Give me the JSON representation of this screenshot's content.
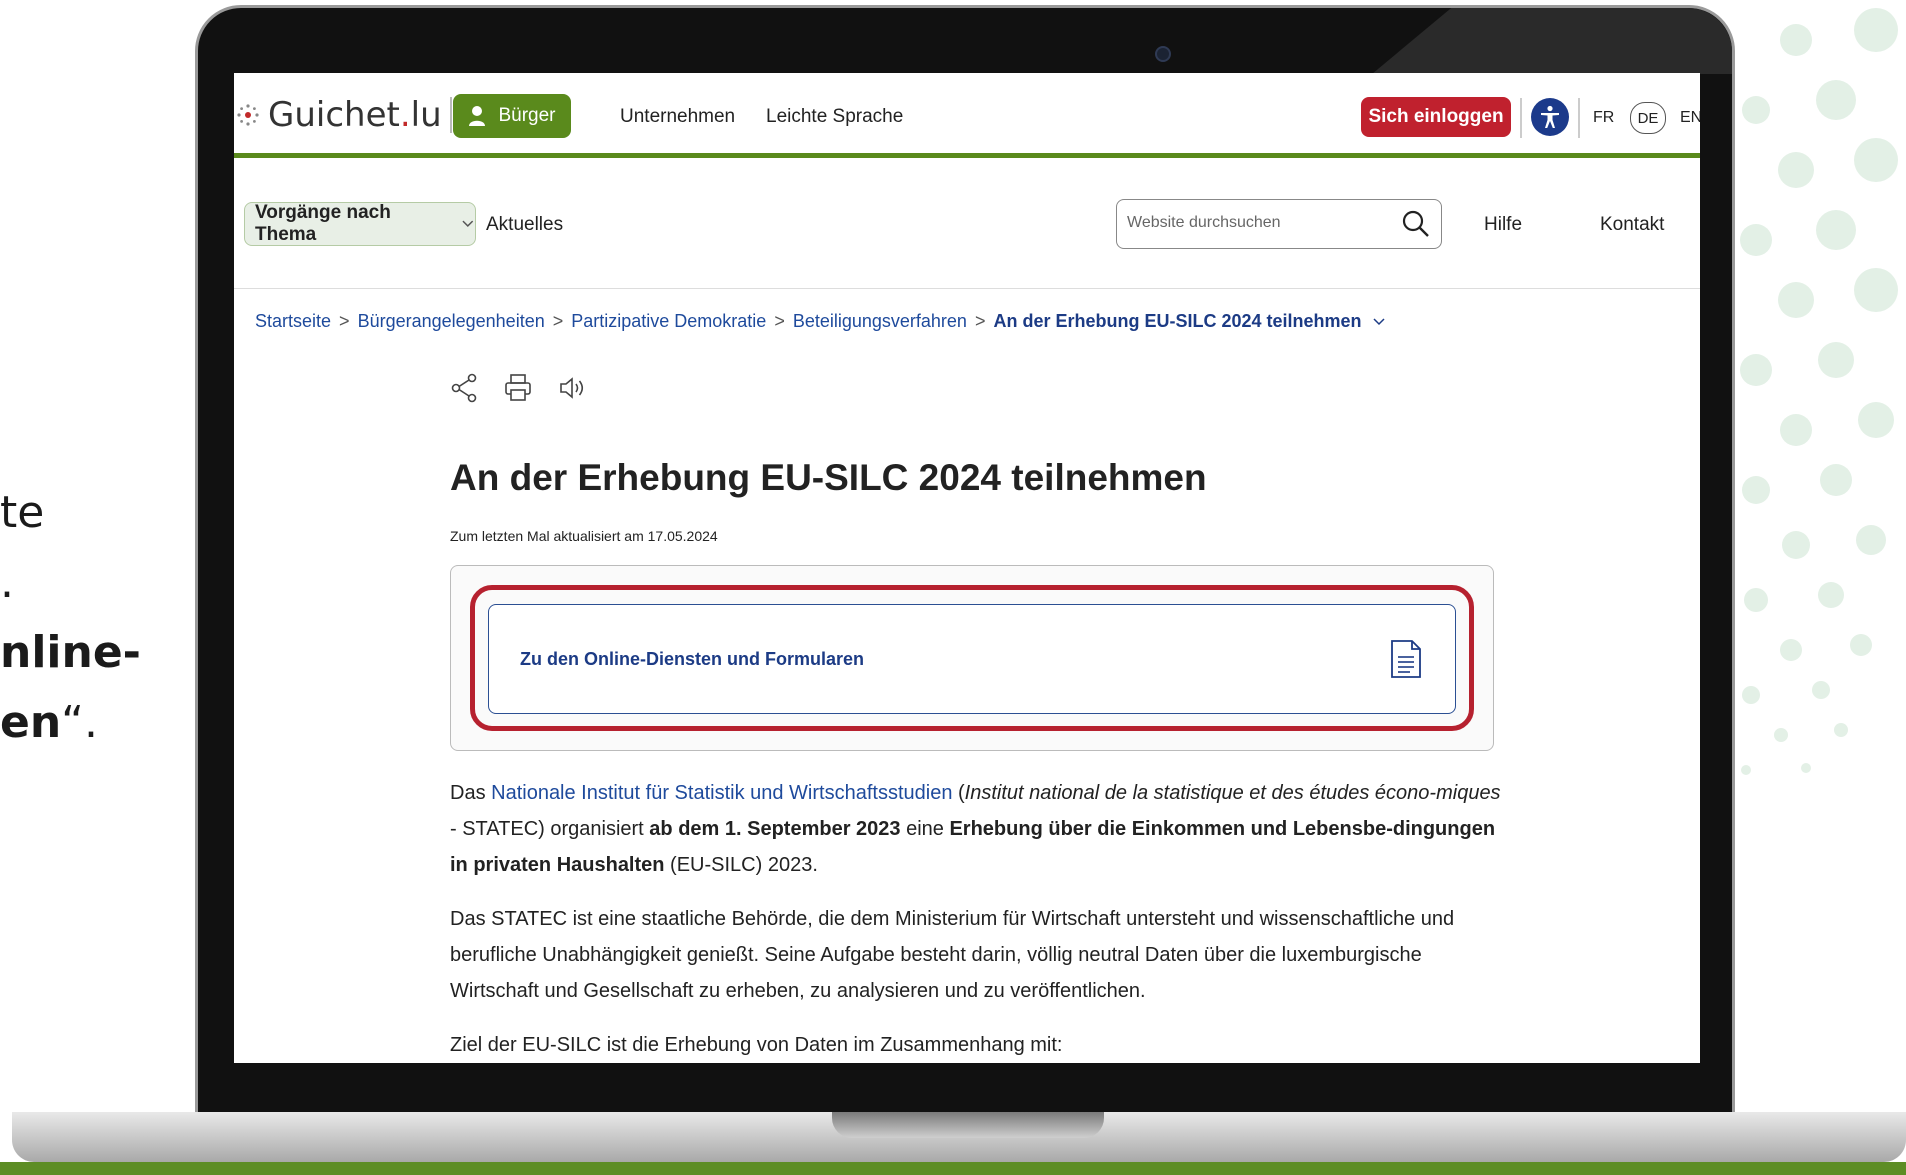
{
  "side_text": {
    "line1": "te",
    "line2": ".",
    "line3": "nline-",
    "line4_bold": "en",
    "line4_rest": "“."
  },
  "header": {
    "logo_text": "Guichet",
    "logo_dot": ".",
    "logo_suffix": "lu",
    "buerger_label": "Bürger",
    "nav_unternehmen": "Unternehmen",
    "nav_leichte_sprache": "Leichte Sprache",
    "login_label": "Sich einloggen",
    "lang_fr": "FR",
    "lang_de": "DE",
    "lang_en": "EN"
  },
  "subbar": {
    "topics_label": "Vorgänge nach Thema",
    "aktuelles_label": "Aktuelles",
    "search_placeholder": "Website durchsuchen",
    "hilfe_label": "Hilfe",
    "kontakt_label": "Kontakt"
  },
  "breadcrumb": {
    "items": [
      "Startseite",
      "Bürgerangelegenheiten",
      "Partizipative Demokratie",
      "Beteiligungsverfahren"
    ],
    "current": "An der Erhebung EU-SILC 2024 teilnehmen",
    "separator": ">"
  },
  "page": {
    "title": "An der Erhebung EU-SILC 2024 teilnehmen",
    "updated": "Zum letzten Mal aktualisiert am 17.05.2024",
    "online_services_label": "Zu den Online-Diensten und Formularen"
  },
  "body": {
    "p1_prefix": "Das ",
    "p1_link": "Nationale Institut für Statistik und Wirtschaftsstudien",
    "p1_paren_open": " (",
    "p1_italic": "Institut national de la statistique et des études écono-miques",
    "p1_mid": " - STATEC) organisiert ",
    "p1_bold1": "ab dem 1. September 2023",
    "p1_mid2": " eine ",
    "p1_bold2": "Erhebung über die Einkommen und Lebensbe-dingungen in privaten Haushalten",
    "p1_suffix": " (EU-SILC) 2023.",
    "p2": "Das STATEC ist eine staatliche Behörde, die dem Ministerium für Wirtschaft untersteht und wissenschaftliche und berufliche Unabhängigkeit genießt. Seine Aufgabe besteht darin, völlig neutral Daten über die luxemburgische Wirtschaft und Gesellschaft zu erheben, zu analysieren und zu veröffentlichen.",
    "p3": "Ziel der EU-SILC ist die Erhebung von Daten im Zusammenhang mit:"
  },
  "icons": {
    "share": "share-icon",
    "print": "print-icon",
    "audio": "speaker-icon",
    "search": "search-icon",
    "accessibility": "accessibility-icon",
    "document": "document-icon",
    "user": "user-icon"
  },
  "colors": {
    "brand_green": "#5a8a1c",
    "login_red": "#c0212e",
    "link_blue": "#1e4a9c",
    "highlight_red": "#b6212f",
    "accessibility_blue": "#1c3a8b"
  }
}
